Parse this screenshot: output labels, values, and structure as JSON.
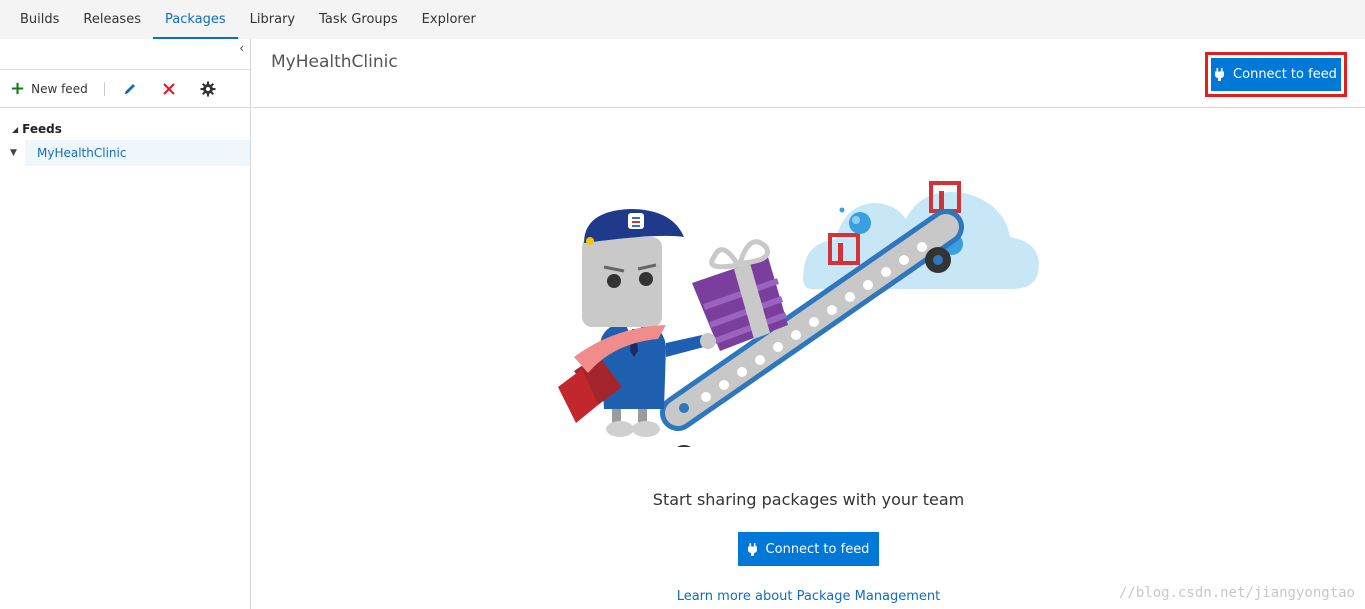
{
  "nav": {
    "tabs": [
      {
        "label": "Builds",
        "active": false
      },
      {
        "label": "Releases",
        "active": false
      },
      {
        "label": "Packages",
        "active": true
      },
      {
        "label": "Library",
        "active": false
      },
      {
        "label": "Task Groups",
        "active": false
      },
      {
        "label": "Explorer",
        "active": false
      }
    ]
  },
  "sidebar": {
    "collapse_glyph": "‹",
    "toolbar": {
      "new_feed_label": "New feed",
      "icons": [
        "plus-icon",
        "pencil-icon",
        "delete-x-icon",
        "gear-icon"
      ]
    },
    "tree": {
      "root_label": "Feeds",
      "items": [
        {
          "label": "MyHealthClinic",
          "selected": true
        }
      ]
    }
  },
  "main": {
    "title": "MyHealthClinic",
    "connect_button_label": "Connect to feed",
    "empty_state": {
      "message": "Start sharing packages with your team",
      "button_label": "Connect to feed",
      "link_text": "Learn more about Package Management"
    }
  },
  "watermark": "//blog.csdn.net/jiangyongtao",
  "colors": {
    "accent": "#0078d7",
    "highlight_border": "#e02020",
    "selection_bg": "#eff6fc",
    "link": "#106ebe"
  }
}
